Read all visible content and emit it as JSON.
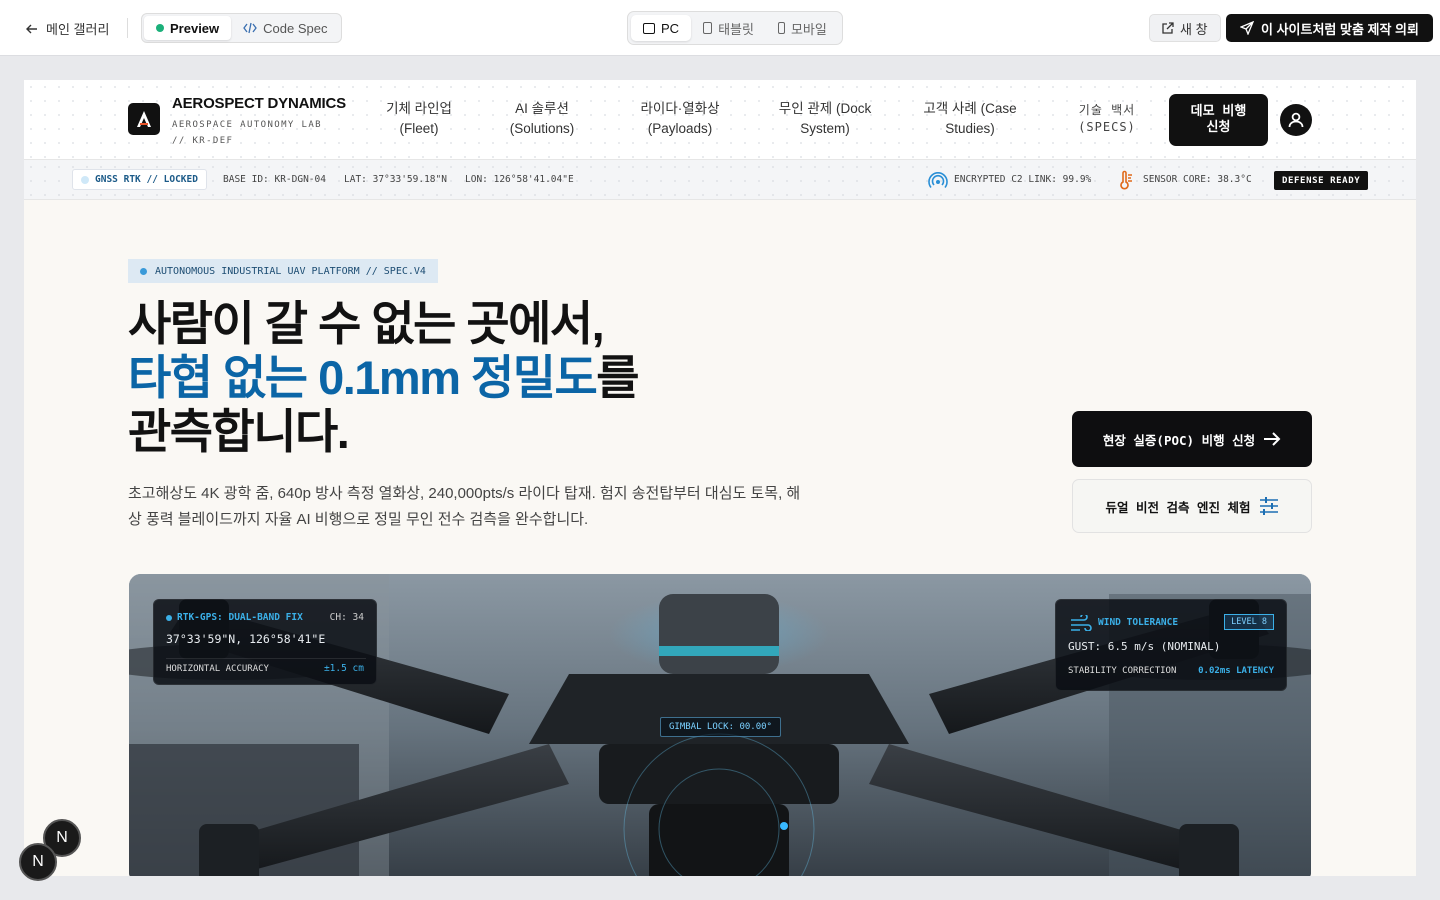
{
  "toolbar": {
    "back_label": "메인 갤러리",
    "preview_label": "Preview",
    "codespec_label": "Code Spec",
    "devices": [
      "PC",
      "태블릿",
      "모바일"
    ],
    "new_window_label": "새 창",
    "commission_label": "이 사이트처럼 맞춤 제작 의뢰"
  },
  "brand": {
    "name": "AEROSPECT DYNAMICS",
    "sub_line1": "AEROSPACE AUTONOMY LAB",
    "sub_line2": "// KR-DEF"
  },
  "nav": {
    "items": [
      {
        "l1": "기체 라인업",
        "l2": "(Fleet)"
      },
      {
        "l1": "AI 솔루션",
        "l2": "(Solutions)"
      },
      {
        "l1": "라이다·열화상",
        "l2": "(Payloads)"
      },
      {
        "l1": "무인 관제 (Dock",
        "l2": "System)"
      },
      {
        "l1": "고객 사례 (Case",
        "l2": "Studies)"
      },
      {
        "l1": "기술 백서",
        "l2": "(SPECS)"
      }
    ],
    "demo_l1": "데모 비행",
    "demo_l2": "신청"
  },
  "status": {
    "gnss": "GNSS RTK // LOCKED",
    "base_id": "BASE ID: KR-DGN-04",
    "lat": "LAT: 37°33'59.18\"N",
    "lon": "LON: 126°58'41.04\"E",
    "c2_link": "ENCRYPTED C2 LINK: 99.9%",
    "sensor_core": "SENSOR CORE: 38.3°C",
    "defense": "DEFENSE READY"
  },
  "hero": {
    "tag": "AUTONOMOUS INDUSTRIAL UAV PLATFORM // SPEC.V4",
    "line1": "사람이 갈 수 없는 곳에서,",
    "line2_blue": "타협 없는 0.1mm 정밀도",
    "line2_rest": "를",
    "line3": "관측합니다.",
    "lede": "초고해상도 4K 광학 줌, 640p 방사 측정 열화상, 240,000pts/s 라이다 탑재. 험지 송전탑부터 대심도 토목, 해상 풍력 블레이드까지 자율 AI 비행으로 정밀 무인 전수 검측을 완수합니다.",
    "cta_primary": "현장 실증(POC) 비행 신청",
    "cta_secondary": "듀얼 비전 검측 엔진 체험"
  },
  "hud_left": {
    "title": "RTK-GPS: DUAL-BAND FIX",
    "channel": "CH: 34",
    "coords": "37°33'59\"N, 126°58'41\"E",
    "acc_label": "HORIZONTAL ACCURACY",
    "acc_value": "±1.5 cm"
  },
  "hud_right": {
    "title": "WIND TOLERANCE",
    "level": "LEVEL 8",
    "gust": "GUST: 6.5 m/s (NOMINAL)",
    "stab_label": "STABILITY CORRECTION",
    "stab_value": "0.02ms LATENCY"
  },
  "gimbal": "GIMBAL LOCK: 00.00°",
  "fab": "N",
  "colors": {
    "accent_blue": "#0b65a6",
    "dark": "#111111",
    "hud_cyan": "#3bb0e8"
  }
}
